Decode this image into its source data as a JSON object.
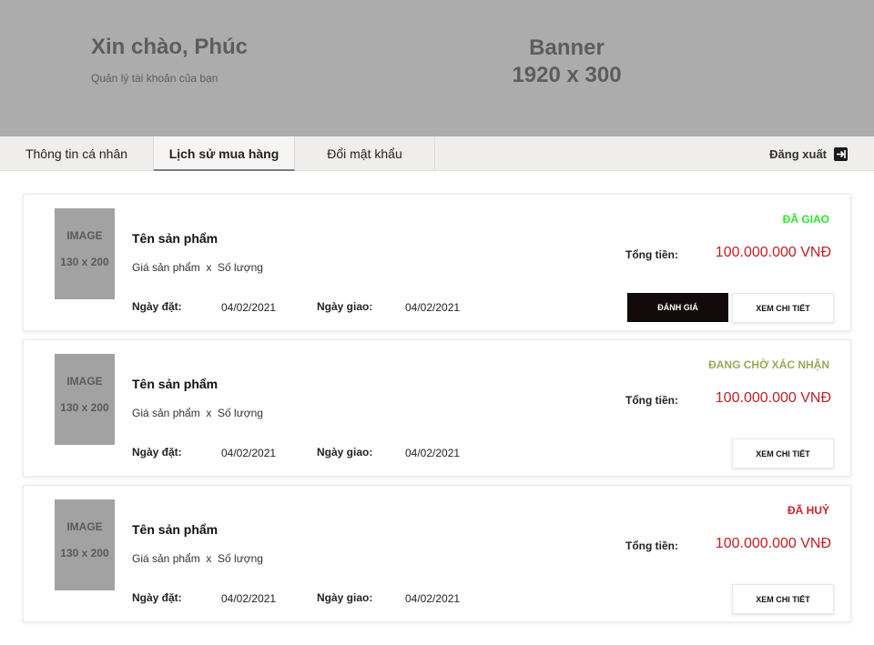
{
  "banner": {
    "greeting": "Xin chào, Phúc",
    "subtitle": "Quản lý tài khoản của bạn",
    "placeholder_line1": "Banner",
    "placeholder_line2": "1920 x 300"
  },
  "tabs": [
    {
      "label": "Thông tin cá nhân",
      "active": false
    },
    {
      "label": "Lịch sử mua hàng",
      "active": true
    },
    {
      "label": "Đổi mật khẩu",
      "active": false
    }
  ],
  "logout": {
    "label": "Đăng xuất",
    "icon": "logout-icon"
  },
  "orders": [
    {
      "image_line1": "IMAGE",
      "image_line2": "130 x 200",
      "product_name": "Tên sản phẩm",
      "quantity_line": "Giá sản phẩm  x  Số lượng",
      "order_date_label": "Ngày đặt:",
      "order_date": "04/02/2021",
      "delivery_date_label": "Ngày giao:",
      "delivery_date": "04/02/2021",
      "status": "ĐÃ GIAO",
      "status_color": "#2ee62e",
      "total_label": "Tổng tiền:",
      "total": "100.000.000 VNĐ",
      "rate_label": "ĐÁNH GIÁ",
      "detail_label": "XEM  CHI TIẾT"
    },
    {
      "image_line1": "IMAGE",
      "image_line2": "130 x 200",
      "product_name": "Tên sản phẩm",
      "quantity_line": "Giá sản phẩm  x  Số lượng",
      "order_date_label": "Ngày đặt:",
      "order_date": "04/02/2021",
      "delivery_date_label": "Ngày giao:",
      "delivery_date": "04/02/2021",
      "status": "ĐANG CHỜ XÁC NHẬN",
      "status_color": "#9aa85a",
      "total_label": "Tổng tiền:",
      "total": "100.000.000 VNĐ",
      "detail_label": "XEM  CHI TIẾT"
    },
    {
      "image_line1": "IMAGE",
      "image_line2": "130 x 200",
      "product_name": "Tên sản phẩm",
      "quantity_line": "Giá sản phẩm  x  Số lượng",
      "order_date_label": "Ngày đặt:",
      "order_date": "04/02/2021",
      "delivery_date_label": "Ngày giao:",
      "delivery_date": "04/02/2021",
      "status": "ĐÃ HUỶ",
      "status_color": "#d0202a",
      "total_label": "Tổng tiền:",
      "total": "100.000.000 VNĐ",
      "detail_label": "XEM  CHI TIẾT"
    }
  ],
  "colors": {
    "banner_bg": "#acacac",
    "tabbar_bg": "#efeeec",
    "price": "#c21e24",
    "rate_button_bg": "#130b0b"
  }
}
